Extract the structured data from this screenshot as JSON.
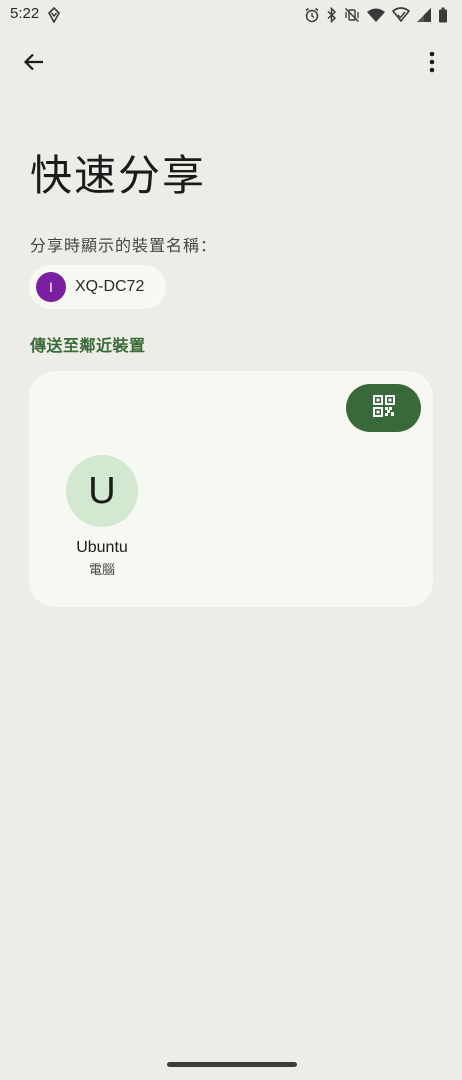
{
  "status_bar": {
    "time": "5:22",
    "icons": [
      "app-notification-icon",
      "alarm-icon",
      "bluetooth-icon",
      "vibrate-off-icon",
      "wifi-icon",
      "wifi-calling-icon",
      "cell-signal-icon",
      "battery-icon"
    ]
  },
  "app_bar": {
    "back_icon": "arrow-back-icon",
    "more_icon": "more-vert-icon"
  },
  "page": {
    "title": "快速分享",
    "device_name_label": "分享時顯示的裝置名稱：",
    "device_chip": {
      "avatar_letter": "I",
      "avatar_color": "#7b1fa2",
      "name": "XQ-DC72"
    },
    "section_header": "傳送至鄰近裝置",
    "nearby_devices": [
      {
        "avatar_letter": "U",
        "name": "Ubuntu",
        "type": "電腦"
      }
    ],
    "qr_button_icon": "qr-code-icon"
  },
  "colors": {
    "background": "#ecede7",
    "card": "#f7f8f2",
    "accent": "#39693b",
    "section_header": "#3c6b3a",
    "device_avatar": "#d3e8d0"
  }
}
